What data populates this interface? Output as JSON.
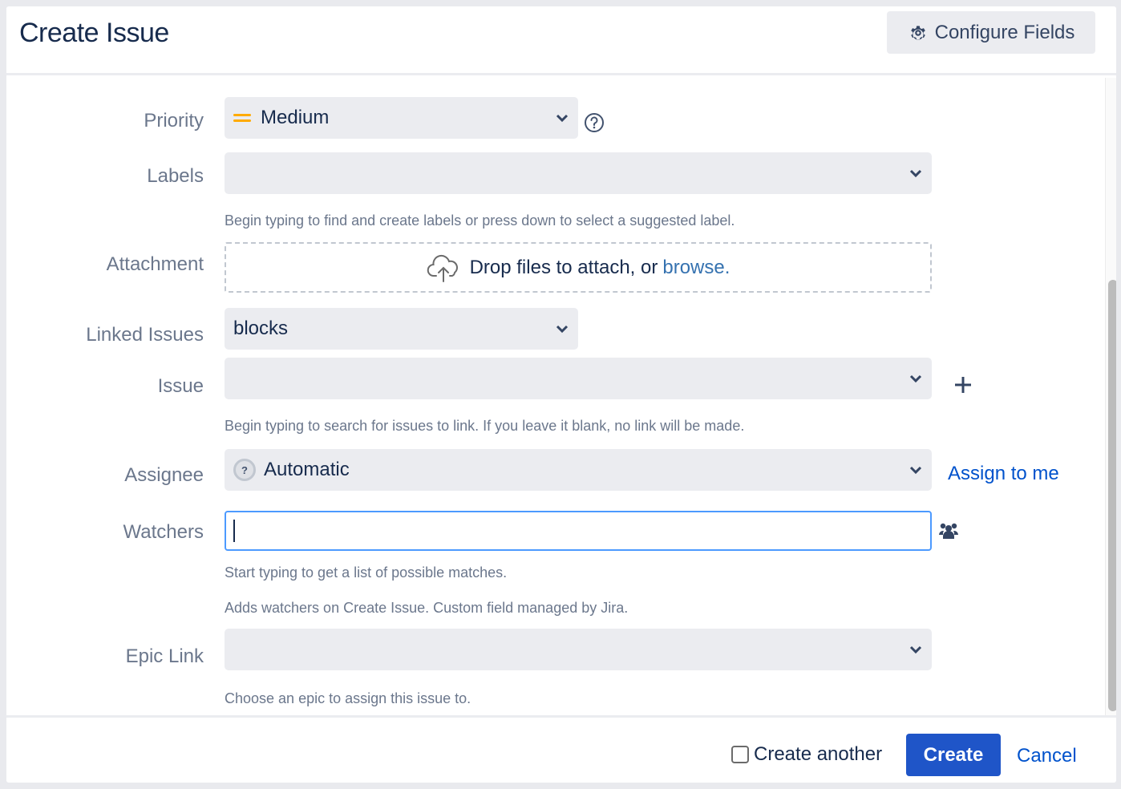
{
  "dialog": {
    "title": "Create Issue",
    "configure_fields_label": "Configure Fields"
  },
  "fields": {
    "priority": {
      "label": "Priority",
      "value": "Medium",
      "priority_color": "#ffab00"
    },
    "labels": {
      "label": "Labels",
      "value": "",
      "hint": "Begin typing to find and create labels or press down to select a suggested label."
    },
    "attachment": {
      "label": "Attachment",
      "drop_text": "Drop files to attach, or",
      "browse_label": "browse."
    },
    "linked_issues": {
      "label": "Linked Issues",
      "value": "blocks"
    },
    "issue": {
      "label": "Issue",
      "value": "",
      "hint": "Begin typing to search for issues to link. If you leave it blank, no link will be made."
    },
    "assignee": {
      "label": "Assignee",
      "value": "Automatic",
      "assign_to_me_label": "Assign to me"
    },
    "watchers": {
      "label": "Watchers",
      "value": "",
      "hint": "Start typing to get a list of possible matches.",
      "description": "Adds watchers on Create Issue. Custom field managed by Jira."
    },
    "epic_link": {
      "label": "Epic Link",
      "value": "",
      "hint": "Choose an epic to assign this issue to."
    }
  },
  "footer": {
    "create_another_label": "Create another",
    "create_another_checked": false,
    "create_label": "Create",
    "cancel_label": "Cancel"
  },
  "colors": {
    "primary": "#0052cc",
    "link": "#0052cc",
    "focus_border": "#4c9aff"
  },
  "icons": {
    "configure": "gear-icon",
    "help": "question-circle-icon",
    "upload": "cloud-upload-icon",
    "add_link": "plus-icon",
    "watchers": "users-icon",
    "dropdown": "chevron-down-icon"
  }
}
